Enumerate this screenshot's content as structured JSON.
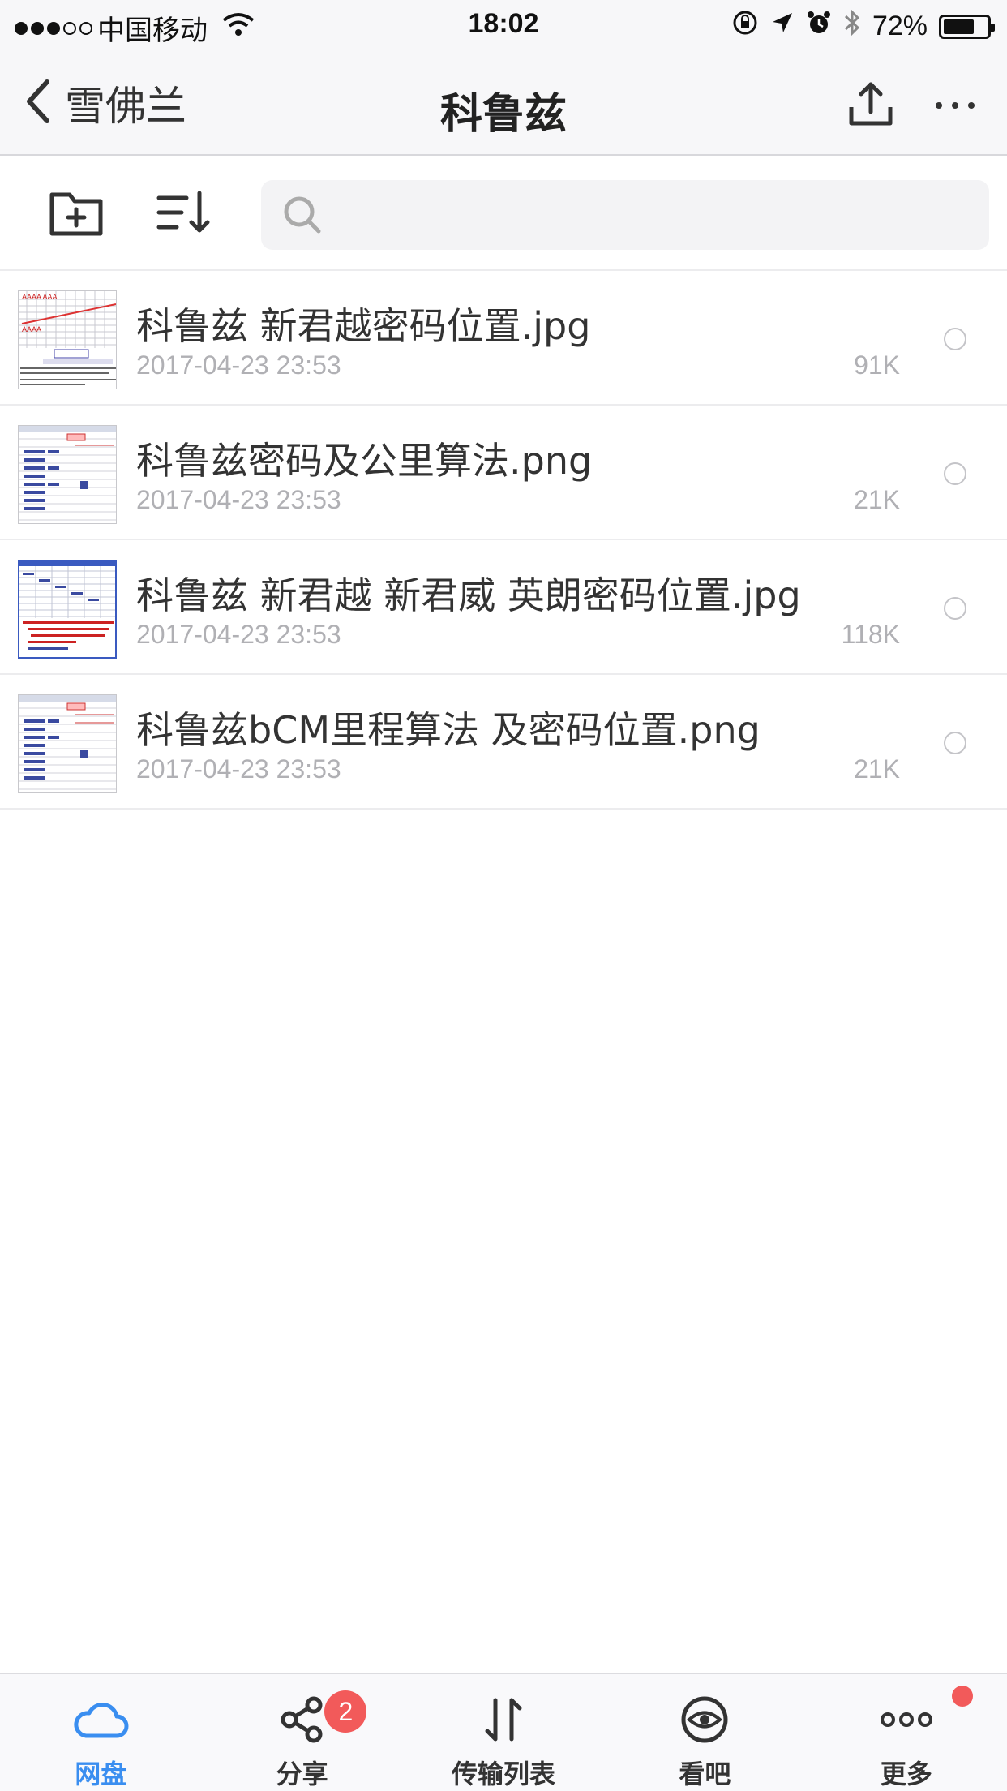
{
  "status_bar": {
    "carrier": "中国移动",
    "time": "18:02",
    "battery_percent": "72%",
    "battery_level": 0.72
  },
  "nav": {
    "back_label": "雪佛兰",
    "title": "科鲁兹"
  },
  "search": {
    "value": "",
    "placeholder": ""
  },
  "files": [
    {
      "name": "科鲁兹 新君越密码位置.jpg",
      "date": "2017-04-23 23:53",
      "size": "91K",
      "thumb": "red-chart"
    },
    {
      "name": "科鲁兹密码及公里算法.png",
      "date": "2017-04-23 23:53",
      "size": "21K",
      "thumb": "table-blue"
    },
    {
      "name": "科鲁兹 新君越 新君威 英朗密码位置.jpg",
      "date": "2017-04-23 23:53",
      "size": "118K",
      "thumb": "blue-border"
    },
    {
      "name": "科鲁兹bCM里程算法 及密码位置.png",
      "date": "2017-04-23 23:53",
      "size": "21K",
      "thumb": "table-blue"
    }
  ],
  "tabs": [
    {
      "label": "网盘",
      "icon": "cloud-icon",
      "active": true
    },
    {
      "label": "分享",
      "icon": "share-icon",
      "badge": "2"
    },
    {
      "label": "传输列表",
      "icon": "transfer-icon"
    },
    {
      "label": "看吧",
      "icon": "eye-icon"
    },
    {
      "label": "更多",
      "icon": "more-icon",
      "dot": true
    }
  ],
  "colors": {
    "accent": "#3a8ef0",
    "badge": "#f25a5a",
    "text": "#333333",
    "meta": "#b0b0b4"
  }
}
